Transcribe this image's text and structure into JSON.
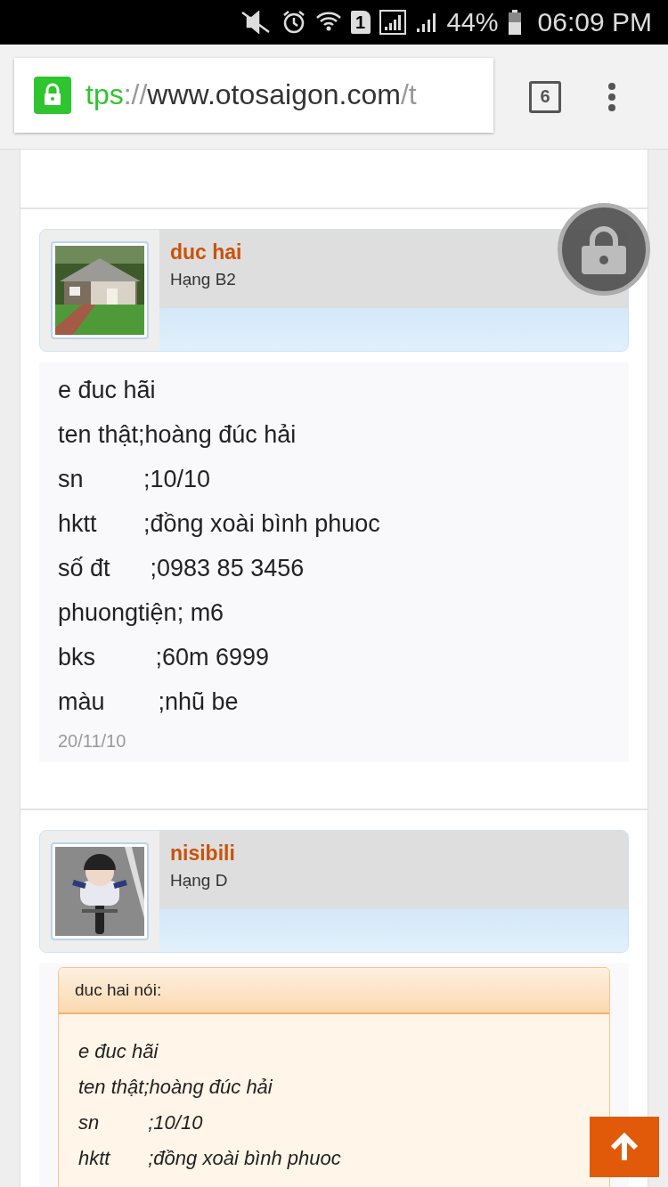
{
  "status_bar": {
    "sim": "1",
    "battery": "44%",
    "time": "06:09 PM"
  },
  "browser": {
    "url": {
      "scheme": "tps",
      "separator": "://",
      "host": "www.otosaigon.com",
      "path": "/t"
    },
    "secure": true,
    "tab_count": "6"
  },
  "posts": [
    {
      "author": "duc hai",
      "rank": "Hạng B2",
      "lines": [
        "e đuc hãi",
        "ten thật;hoàng đúc hải",
        "sn         ;10/10",
        "hktt       ;đồng xoài bình phuoc",
        "số đt      ;0983 85 3456",
        "phuongtiện; m6",
        "bks         ;60m 6999",
        "màu        ;nhũ be"
      ],
      "date": "20/11/10"
    },
    {
      "author": "nisibili",
      "rank": "Hạng D",
      "quote": {
        "header": "duc hai nói:",
        "lines": [
          "e đuc hãi",
          "ten thật;hoàng đúc hải",
          "sn         ;10/10",
          "hktt       ;đồng xoài bình phuoc"
        ]
      }
    }
  ]
}
